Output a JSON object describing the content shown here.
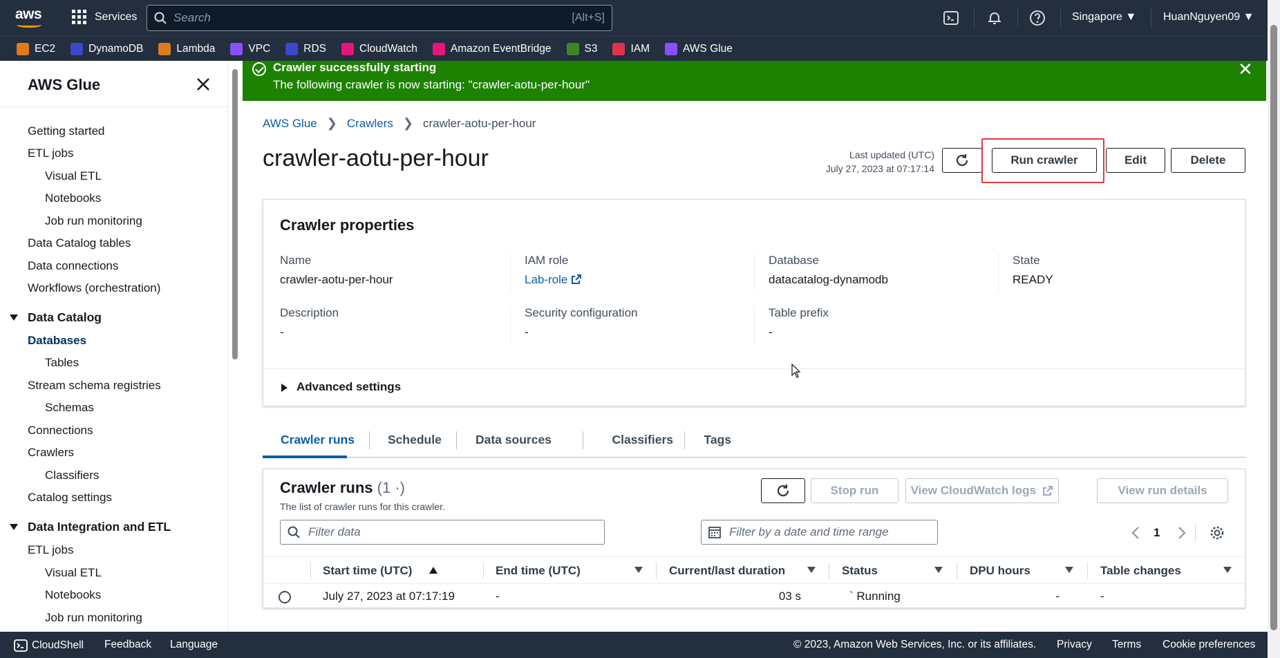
{
  "topnav": {
    "logo": "aws",
    "services_label": "Services",
    "search_placeholder": "Search",
    "search_shortcut": "[Alt+S]",
    "region": "Singapore ▼",
    "user": "HuanNguyen09 ▼",
    "icons": [
      "cloudshell-icon",
      "bell-icon",
      "help-icon"
    ]
  },
  "favorites": [
    {
      "label": "EC2",
      "color": "#e07a1f"
    },
    {
      "label": "DynamoDB",
      "color": "#3b48cc"
    },
    {
      "label": "Lambda",
      "color": "#e07a1f"
    },
    {
      "label": "VPC",
      "color": "#8c4fff"
    },
    {
      "label": "RDS",
      "color": "#3b48cc"
    },
    {
      "label": "CloudWatch",
      "color": "#e7157b"
    },
    {
      "label": "Amazon EventBridge",
      "color": "#e7157b"
    },
    {
      "label": "S3",
      "color": "#3f8624"
    },
    {
      "label": "IAM",
      "color": "#dd344c"
    },
    {
      "label": "AWS Glue",
      "color": "#8c4fff"
    }
  ],
  "sidebar": {
    "title": "AWS Glue",
    "items": [
      {
        "label": "Getting started"
      },
      {
        "label": "ETL jobs"
      },
      {
        "label": "Visual ETL"
      },
      {
        "label": "Notebooks"
      },
      {
        "label": "Job run monitoring"
      },
      {
        "label": "Data Catalog tables"
      },
      {
        "label": "Data connections"
      },
      {
        "label": "Workflows (orchestration)"
      },
      {
        "label": "Data Catalog"
      },
      {
        "label": "Databases"
      },
      {
        "label": "Tables"
      },
      {
        "label": "Stream schema registries"
      },
      {
        "label": "Schemas"
      },
      {
        "label": "Connections"
      },
      {
        "label": "Crawlers"
      },
      {
        "label": "Classifiers"
      },
      {
        "label": "Catalog settings"
      },
      {
        "label": "Data Integration and ETL"
      },
      {
        "label": "ETL jobs"
      },
      {
        "label": "Visual ETL"
      },
      {
        "label": "Notebooks"
      },
      {
        "label": "Job run monitoring"
      }
    ]
  },
  "flash": {
    "header": "Crawler successfully starting",
    "message": "The following crawler is now starting: \"crawler-aotu-per-hour\"",
    "close": "✕"
  },
  "breadcrumb": [
    "AWS Glue",
    "Crawlers",
    "crawler-aotu-per-hour"
  ],
  "page": {
    "title": "crawler-aotu-per-hour",
    "last_updated_label": "Last updated (UTC)",
    "last_updated_value": "July 27, 2023 at 07:17:14",
    "run_button": "Run crawler",
    "edit_button": "Edit",
    "delete_button": "Delete"
  },
  "properties": {
    "heading": "Crawler properties",
    "name_label": "Name",
    "name_value": "crawler-aotu-per-hour",
    "iam_label": "IAM role",
    "iam_value": "Lab-role",
    "db_label": "Database",
    "db_value": "datacatalog-dynamodb",
    "state_label": "State",
    "state_value": "READY",
    "desc_label": "Description",
    "desc_value": "-",
    "sec_label": "Security configuration",
    "sec_value": "-",
    "prefix_label": "Table prefix",
    "prefix_value": "-",
    "advanced": "Advanced settings"
  },
  "tabs": [
    "Crawler runs",
    "Schedule",
    "Data sources",
    "Classifiers",
    "Tags"
  ],
  "runs": {
    "title": "Crawler runs",
    "count": "(1  ·)",
    "description": "The list of crawler runs for this crawler.",
    "stop_button": "Stop run",
    "cw_button": "View CloudWatch logs",
    "details_button": "View run details",
    "filter_placeholder": "Filter data",
    "date_placeholder": "Filter by a date and time range",
    "page": "1",
    "columns": [
      "Start time (UTC)",
      "End time (UTC)",
      "Current/last duration",
      "Status",
      "DPU hours",
      "Table changes"
    ],
    "rows": [
      {
        "start": "July 27, 2023 at 07:17:19",
        "end": "-",
        "duration": "03 s",
        "status": "Running",
        "status_prefix": "`",
        "dpu": "-",
        "changes": "-"
      }
    ]
  },
  "footer": {
    "cloudshell": "CloudShell",
    "feedback": "Feedback",
    "language": "Language",
    "copyright": "© 2023, Amazon Web Services, Inc. or its affiliates.",
    "privacy": "Privacy",
    "terms": "Terms",
    "cookies": "Cookie preferences"
  }
}
